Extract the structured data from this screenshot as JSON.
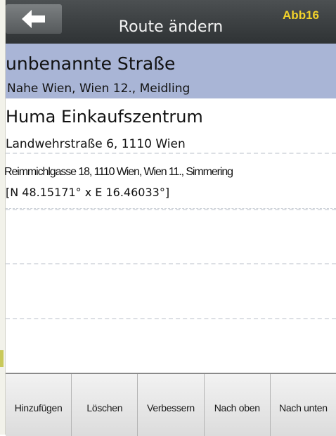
{
  "header": {
    "title": "Route ändern",
    "badge": "Abb16"
  },
  "route": [
    {
      "title": "unbenannte Straße",
      "subtitle": "Nahe Wien, Wien 12., Meidling"
    },
    {
      "title": "Huma Einkaufszentrum",
      "subtitle": "Landwehrstraße 6, 1110 Wien",
      "address": "Reimmichlgasse 18, 1110 Wien, Wien 11., Simmering",
      "coordinates": "[N 48.15171° x E 16.46033°]"
    }
  ],
  "toolbar": {
    "add": "Hinzufügen",
    "delete": "Löschen",
    "improve": "Verbessern",
    "move_up": "Nach oben",
    "move_down": "Nach unten"
  }
}
